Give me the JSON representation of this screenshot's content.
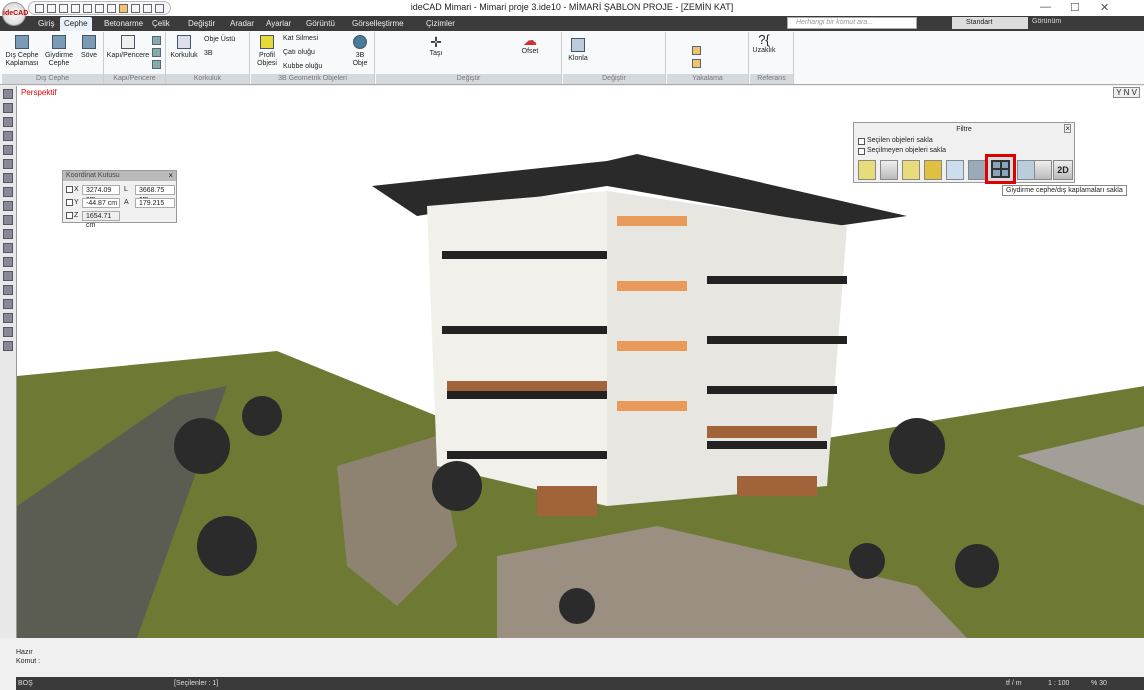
{
  "app": {
    "logo": "ideCAD",
    "title": "ideCAD Mimari - Mimari proje 3.ide10 - MİMARİ ŞABLON PROJE - [ZEMİN KAT]"
  },
  "tabs": [
    "Giriş",
    "Cephe",
    "Betonarme",
    "Çelik",
    "Değiştir",
    "Aradar",
    "Ayarlar",
    "Görüntü",
    "Görselleştirme",
    "Çizimler"
  ],
  "active_tab": "Cephe",
  "search": {
    "placeholder": "Herhangi bir komut ara..."
  },
  "style_select": "Standart",
  "view_menu": "Görünüm",
  "ribbon": {
    "dis_cephe": {
      "label": "Dış Cephe",
      "buttons": [
        "Dış Cephe Kaplaması",
        "Giydirme Cephe",
        "Söve"
      ]
    },
    "kapi": {
      "label": "Kapı/Pencere",
      "buttons": [
        "Kapı/Pencere"
      ]
    },
    "korkuluk": {
      "label": "Korkuluk",
      "buttons": [
        "Korkuluk",
        "Obje Üstü",
        "3B"
      ]
    },
    "geo": {
      "label": "3B Geometrik Objeleri",
      "buttons": [
        "Profil Objesi",
        "Kat Silmesi",
        "Çatı oluğu",
        "Kubbe oluğu",
        "3B Obje"
      ]
    },
    "degistir1": {
      "label": "Değiştir",
      "buttons": [
        "Taşı",
        "Ofset"
      ]
    },
    "degistir2": {
      "label": "Değiştir",
      "buttons": [
        "Klonla"
      ]
    },
    "yakalama": {
      "label": "Yakalama"
    },
    "referans": {
      "label": "Referans",
      "buttons": [
        "Uzaklık"
      ]
    }
  },
  "viewport": {
    "label": "Perspektif",
    "corner": "Y N V"
  },
  "koordinat": {
    "title": "Koordinat Kutusu",
    "x": "3274.09 cm",
    "y": "-44.87 cm",
    "z": "1654.71 cm",
    "l_label": "L",
    "l": "3668.75 cm",
    "a_label": "A",
    "a": "179.215",
    "x_label": "X",
    "y_label": "Y",
    "z_label": "Z"
  },
  "filtre": {
    "title": "Filtre",
    "opt1": "Seçilen objeleri sakla",
    "opt2": "Seçilmeyen objeleri sakla",
    "btn_2d": "2D",
    "tooltip": "Giydirme cephe/dış kaplamaları sakla",
    "highlight": "#e00000"
  },
  "command": {
    "status": "Hazır",
    "prompt": "Komut :"
  },
  "statusbar": {
    "mode": "BOŞ",
    "selected": "[Seçilenler : 1]",
    "units": "tf / m",
    "scale": "1 : 100",
    "zoom": "% 30"
  }
}
